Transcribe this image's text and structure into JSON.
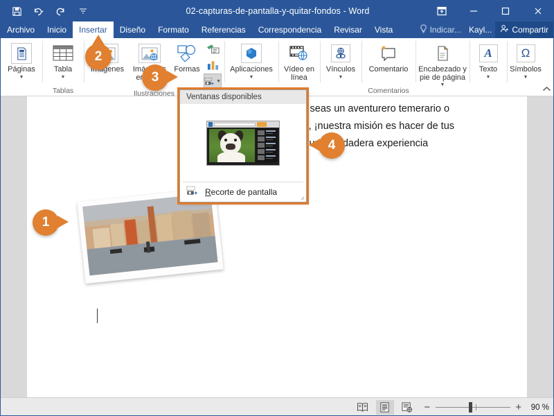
{
  "window": {
    "title": "02-capturas-de-pantalla-y-quitar-fondos  -  Word",
    "quick_access": [
      {
        "name": "save",
        "glyph": "save-icon"
      },
      {
        "name": "undo",
        "glyph": "undo-icon"
      },
      {
        "name": "redo",
        "glyph": "redo-icon"
      },
      {
        "name": "customize",
        "glyph": "customize-qat-icon"
      }
    ],
    "controls": [
      {
        "name": "ribbon-display-options",
        "glyph": "ribbon-options-icon"
      },
      {
        "name": "minimize",
        "glyph": "minimize-icon"
      },
      {
        "name": "maximize",
        "glyph": "maximize-icon"
      },
      {
        "name": "close",
        "glyph": "close-icon"
      }
    ]
  },
  "tabs": [
    {
      "label": "Archivo",
      "active": false
    },
    {
      "label": "Inicio",
      "active": false
    },
    {
      "label": "Insertar",
      "active": true
    },
    {
      "label": "Diseño",
      "active": false
    },
    {
      "label": "Formato",
      "active": false
    },
    {
      "label": "Referencias",
      "active": false
    },
    {
      "label": "Correspondencia",
      "active": false
    },
    {
      "label": "Revisar",
      "active": false
    },
    {
      "label": "Vista",
      "active": false
    }
  ],
  "tabstrip_right": {
    "tell_me": "Indicar...",
    "user": "Kayl...",
    "share": "Compartir"
  },
  "ribbon": {
    "groups": [
      {
        "label": "",
        "items": [
          {
            "label": "Páginas",
            "has_caret": true,
            "icon": "pages-icon"
          }
        ]
      },
      {
        "label": "Tablas",
        "items": [
          {
            "label": "Tabla",
            "has_caret": true,
            "icon": "table-icon"
          }
        ]
      },
      {
        "label": "Ilustraciones",
        "items": [
          {
            "label": "Imágenes",
            "has_caret": false,
            "icon": "pictures-icon"
          },
          {
            "label": "Imágenes en línea",
            "has_caret": false,
            "icon": "online-pictures-icon"
          },
          {
            "label": "Formas",
            "has_caret": false,
            "icon": "shapes-icon"
          },
          {
            "label": "SmartArt",
            "has_caret": false,
            "icon": "smartart-icon"
          },
          {
            "label": "Gráfico",
            "has_caret": false,
            "icon": "chart-icon"
          },
          {
            "label": "Captura",
            "has_caret": true,
            "icon": "screenshot-icon"
          }
        ]
      },
      {
        "label": "",
        "items": [
          {
            "label": "Aplicaciones",
            "has_caret": true,
            "icon": "apps-icon"
          }
        ]
      },
      {
        "label": "",
        "items": [
          {
            "label": "Vídeo en línea",
            "has_caret": false,
            "icon": "online-video-icon"
          }
        ]
      },
      {
        "label": "",
        "items": [
          {
            "label": "Vínculos",
            "has_caret": true,
            "icon": "links-icon"
          }
        ]
      },
      {
        "label": "Comentarios",
        "items": [
          {
            "label": "Comentario",
            "has_caret": false,
            "icon": "comment-icon"
          }
        ]
      },
      {
        "label": "",
        "items": [
          {
            "label": "Encabezado y pie de página",
            "has_caret": true,
            "icon": "header-footer-icon"
          }
        ]
      },
      {
        "label": "",
        "items": [
          {
            "label": "Texto",
            "has_caret": true,
            "icon": "text-icon"
          }
        ]
      },
      {
        "label": "",
        "items": [
          {
            "label": "Símbolos",
            "has_caret": true,
            "icon": "symbols-icon"
          }
        ]
      }
    ],
    "collapse_label": "collapse-ribbon-icon"
  },
  "dropdown": {
    "header": "Ventanas disponibles",
    "screen_clipping_prefix": "R",
    "screen_clipping_rest": "ecorte de pantalla",
    "thumbnail_name": "available-window-thumbnail"
  },
  "document": {
    "lines": [
      "a. Ya seas un aventurero temerario o",
      "asual, ¡nuestra misión es hacer de tus",
      "ones una verdadera experiencia"
    ],
    "photo_alt": "venice-canal-photo"
  },
  "callouts": [
    {
      "number": "1",
      "direction": "right"
    },
    {
      "number": "2",
      "direction": "up"
    },
    {
      "number": "3",
      "direction": "right"
    },
    {
      "number": "4",
      "direction": "left"
    }
  ],
  "statusbar": {
    "views": [
      {
        "name": "read-mode",
        "active": false
      },
      {
        "name": "print-layout",
        "active": true
      },
      {
        "name": "web-layout",
        "active": false
      }
    ],
    "zoom_minus": "−",
    "zoom_plus": "+",
    "zoom_level": "90 %"
  },
  "colors": {
    "accent": "#2b579a",
    "callout": "#e08030",
    "highlight": "#e07b2c"
  }
}
